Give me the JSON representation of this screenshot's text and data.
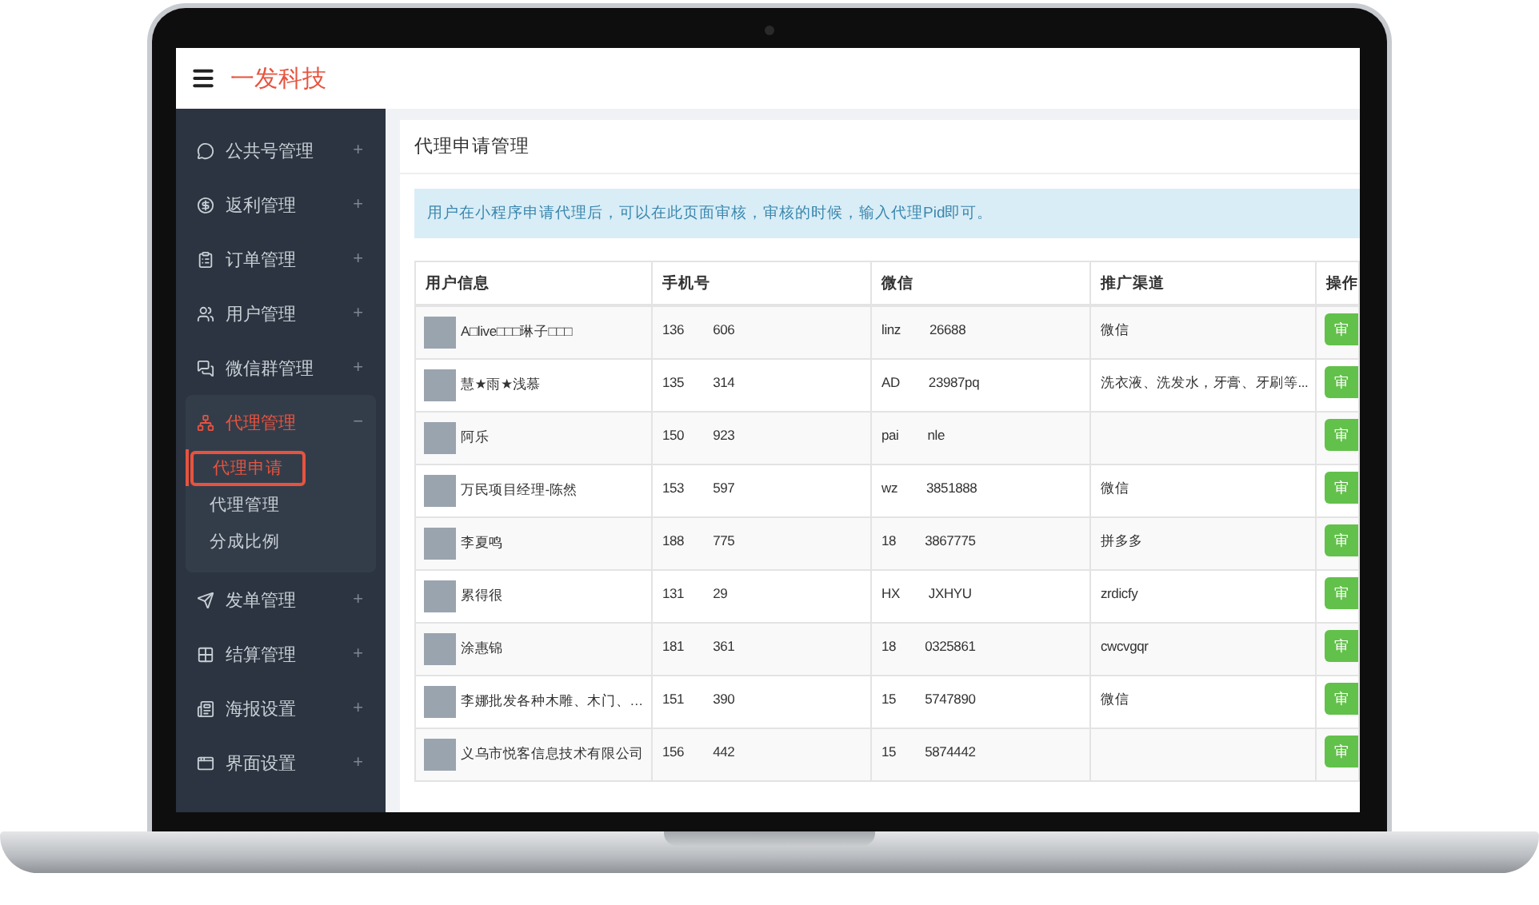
{
  "header": {
    "logo": "一发科技"
  },
  "sidebar": {
    "items": [
      {
        "label": "公共号管理",
        "expanded": false,
        "toggle": "+"
      },
      {
        "label": "返利管理",
        "expanded": false,
        "toggle": "+"
      },
      {
        "label": "订单管理",
        "expanded": false,
        "toggle": "+"
      },
      {
        "label": "用户管理",
        "expanded": false,
        "toggle": "+"
      },
      {
        "label": "微信群管理",
        "expanded": false,
        "toggle": "+"
      },
      {
        "label": "代理管理",
        "expanded": true,
        "toggle": "−",
        "children": [
          {
            "label": "代理申请",
            "selected": true
          },
          {
            "label": "代理管理",
            "selected": false
          },
          {
            "label": "分成比例",
            "selected": false
          }
        ]
      },
      {
        "label": "发单管理",
        "expanded": false,
        "toggle": "+"
      },
      {
        "label": "结算管理",
        "expanded": false,
        "toggle": "+"
      },
      {
        "label": "海报设置",
        "expanded": false,
        "toggle": "+"
      },
      {
        "label": "界面设置",
        "expanded": false,
        "toggle": "+"
      }
    ]
  },
  "panel": {
    "title": "代理申请管理",
    "notice": "用户在小程序申请代理后，可以在此页面审核，审核的时候，输入代理Pid即可。"
  },
  "table": {
    "columns": [
      "用户信息",
      "手机号",
      "微信",
      "推广渠道",
      "操作"
    ],
    "rows": [
      {
        "name": "A□live□□□琳子□□□",
        "phone": [
          "136",
          "606"
        ],
        "wechat": [
          "linz",
          "26688"
        ],
        "channel": "微信",
        "action": "审"
      },
      {
        "name": "慧★雨★浅慕",
        "phone": [
          "135",
          "314"
        ],
        "wechat": [
          "AD",
          "23987pq"
        ],
        "channel": "洗衣液、洗发水，牙膏、牙刷等...",
        "action": "审"
      },
      {
        "name": "阿乐",
        "phone": [
          "150",
          "923"
        ],
        "wechat": [
          "pai",
          "nle"
        ],
        "action": "审"
      },
      {
        "name": "万民项目经理-陈然",
        "phone": [
          "153",
          "597"
        ],
        "wechat": [
          "wz",
          "3851888"
        ],
        "channel": "微信",
        "action": "审"
      },
      {
        "name": "李夏鸣",
        "phone": [
          "188",
          "775"
        ],
        "wechat": [
          "18",
          "3867775"
        ],
        "channel": "拼多多",
        "action": "审"
      },
      {
        "name": "累得很",
        "phone": [
          "131",
          "29"
        ],
        "wechat": [
          "HX",
          "JXHYU"
        ],
        "channel": "zrdicfy",
        "action": "审"
      },
      {
        "name": "涂惠锦",
        "phone": [
          "181",
          "361"
        ],
        "wechat": [
          "18",
          "0325861"
        ],
        "channel": "cwcvgqr",
        "action": "审"
      },
      {
        "name": "李娜批发各种木雕、木门、…",
        "phone": [
          "151",
          "390"
        ],
        "wechat": [
          "15",
          "5747890"
        ],
        "channel": "微信",
        "action": "审"
      },
      {
        "name": "义乌市悦客信息技术有限公司",
        "phone": [
          "156",
          "442"
        ],
        "wechat": [
          "15",
          "5874442"
        ],
        "action": "审"
      }
    ]
  }
}
